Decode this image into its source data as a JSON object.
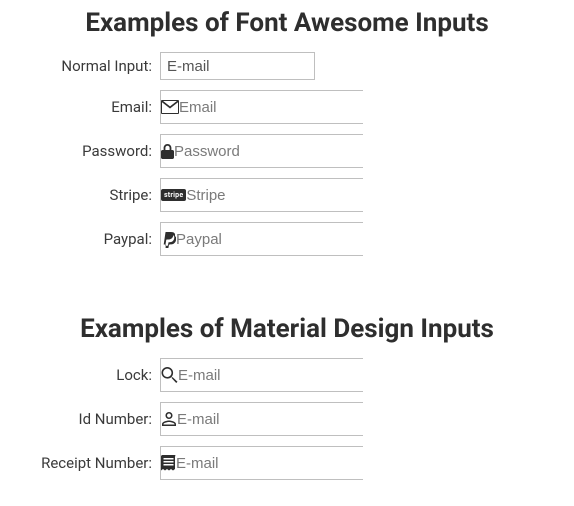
{
  "section1": {
    "heading": "Examples of Font Awesome Inputs",
    "rows": [
      {
        "label": "Normal Input:",
        "placeholder": "E-mail"
      },
      {
        "label": "Email:",
        "placeholder": "Email"
      },
      {
        "label": "Password:",
        "placeholder": "Password"
      },
      {
        "label": "Stripe:",
        "placeholder": "Stripe"
      },
      {
        "label": "Paypal:",
        "placeholder": "Paypal"
      }
    ],
    "stripe_badge_text": "stripe"
  },
  "section2": {
    "heading": "Examples of Material Design Inputs",
    "rows": [
      {
        "label": "Lock:",
        "placeholder": "E-mail"
      },
      {
        "label": "Id Number:",
        "placeholder": "E-mail"
      },
      {
        "label": "Receipt Number:",
        "placeholder": "E-mail"
      }
    ]
  }
}
